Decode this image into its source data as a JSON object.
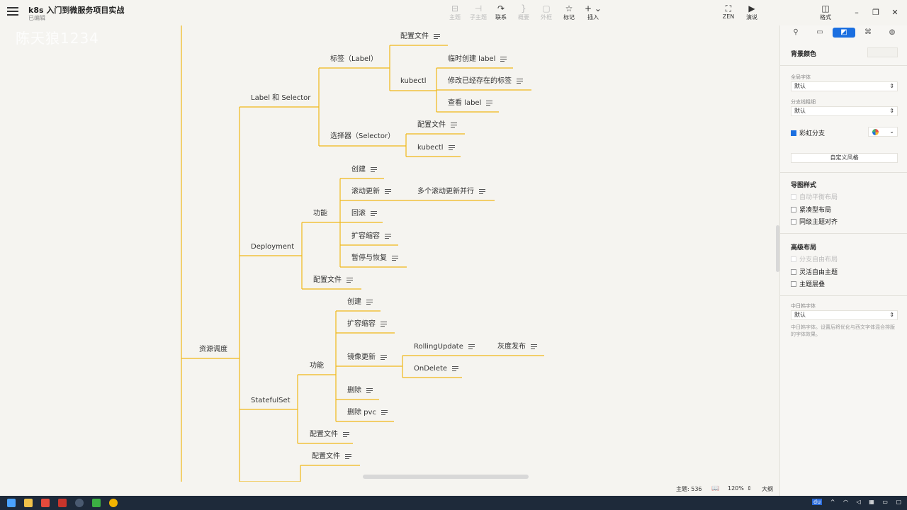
{
  "header": {
    "doc_title": "k8s 入门到微服务项目实战",
    "doc_status": "已编辑",
    "tools": [
      {
        "label": "主题",
        "icon": "subtopic-icon",
        "enabled": false
      },
      {
        "label": "子主题",
        "icon": "child-topic-icon",
        "enabled": false
      },
      {
        "label": "联系",
        "icon": "relation-icon",
        "enabled": true
      },
      {
        "label": "概要",
        "icon": "summary-icon",
        "enabled": false
      },
      {
        "label": "外框",
        "icon": "boundary-icon",
        "enabled": false
      },
      {
        "label": "标记",
        "icon": "star-icon",
        "enabled": true
      },
      {
        "label": "插入",
        "icon": "plus-icon",
        "enabled": true
      },
      {
        "label": "ZEN",
        "icon": "fullscreen-icon",
        "enabled": true
      },
      {
        "label": "演说",
        "icon": "present-icon",
        "enabled": true
      },
      {
        "label": "格式",
        "icon": "format-panel-icon",
        "enabled": true
      }
    ]
  },
  "watermark": "陈天狼1234",
  "mindmap": {
    "root": "资源调度",
    "nodes": {
      "label_selector": "Label 和 Selector",
      "label": "标签（Label）",
      "label_config": "配置文件",
      "label_kubectl": "kubectl",
      "label_temp_create": "临时创建 label",
      "label_modify": "修改已经存在的标签",
      "label_view": "查看 label",
      "selector": "选择器（Selector）",
      "selector_config": "配置文件",
      "selector_kubectl": "kubectl",
      "deployment": "Deployment",
      "deploy_func": "功能",
      "deploy_create": "创建",
      "deploy_rolling": "滚动更新",
      "deploy_multi_rolling": "多个滚动更新并行",
      "deploy_rollback": "回滚",
      "deploy_scale": "扩容缩容",
      "deploy_pause": "暂停与恢复",
      "deploy_config": "配置文件",
      "statefulset": "StatefulSet",
      "sts_func": "功能",
      "sts_create": "创建",
      "sts_scale": "扩容缩容",
      "sts_image_update": "镜像更新",
      "sts_rolling": "RollingUpdate",
      "sts_canary": "灰度发布",
      "sts_ondelete": "OnDelete",
      "sts_delete": "删除",
      "sts_delete_pvc": "删除 pvc",
      "sts_config": "配置文件",
      "next_config": "配置文件"
    },
    "line_color": "#f0b818"
  },
  "statusbar": {
    "topic_count": "主题: 536",
    "zoom": "120%",
    "outline": "大纲"
  },
  "panel": {
    "tabs": [
      "style-icon",
      "topic-icon",
      "canvas-icon",
      "marker-icon",
      "brush-icon"
    ],
    "bg_color_label": "背景颜色",
    "global_font_label": "全局字体",
    "global_font_value": "默认",
    "branch_thickness_label": "分支线粗细",
    "branch_thickness_value": "默认",
    "rainbow_branch_label": "彩虹分支",
    "custom_style_label": "自定义风格",
    "map_style_heading": "导图样式",
    "auto_balance_label": "自动平衡布局",
    "compact_layout_label": "紧凑型布局",
    "sibling_align_label": "同级主题对齐",
    "advanced_layout_heading": "高级布局",
    "branch_free_label": "分支自由布局",
    "flexible_free_label": "灵活自由主题",
    "overlap_label": "主题层叠",
    "cjk_font_label": "中日韩字体",
    "cjk_font_value": "默认",
    "cjk_font_desc": "中日韩字体。设置后将优化与西文字体混合排版的字体效果。"
  },
  "taskbar": {
    "tray_items": [
      "du",
      "^",
      "wifi",
      "volume",
      "keyboard",
      "battery",
      "notify"
    ]
  }
}
